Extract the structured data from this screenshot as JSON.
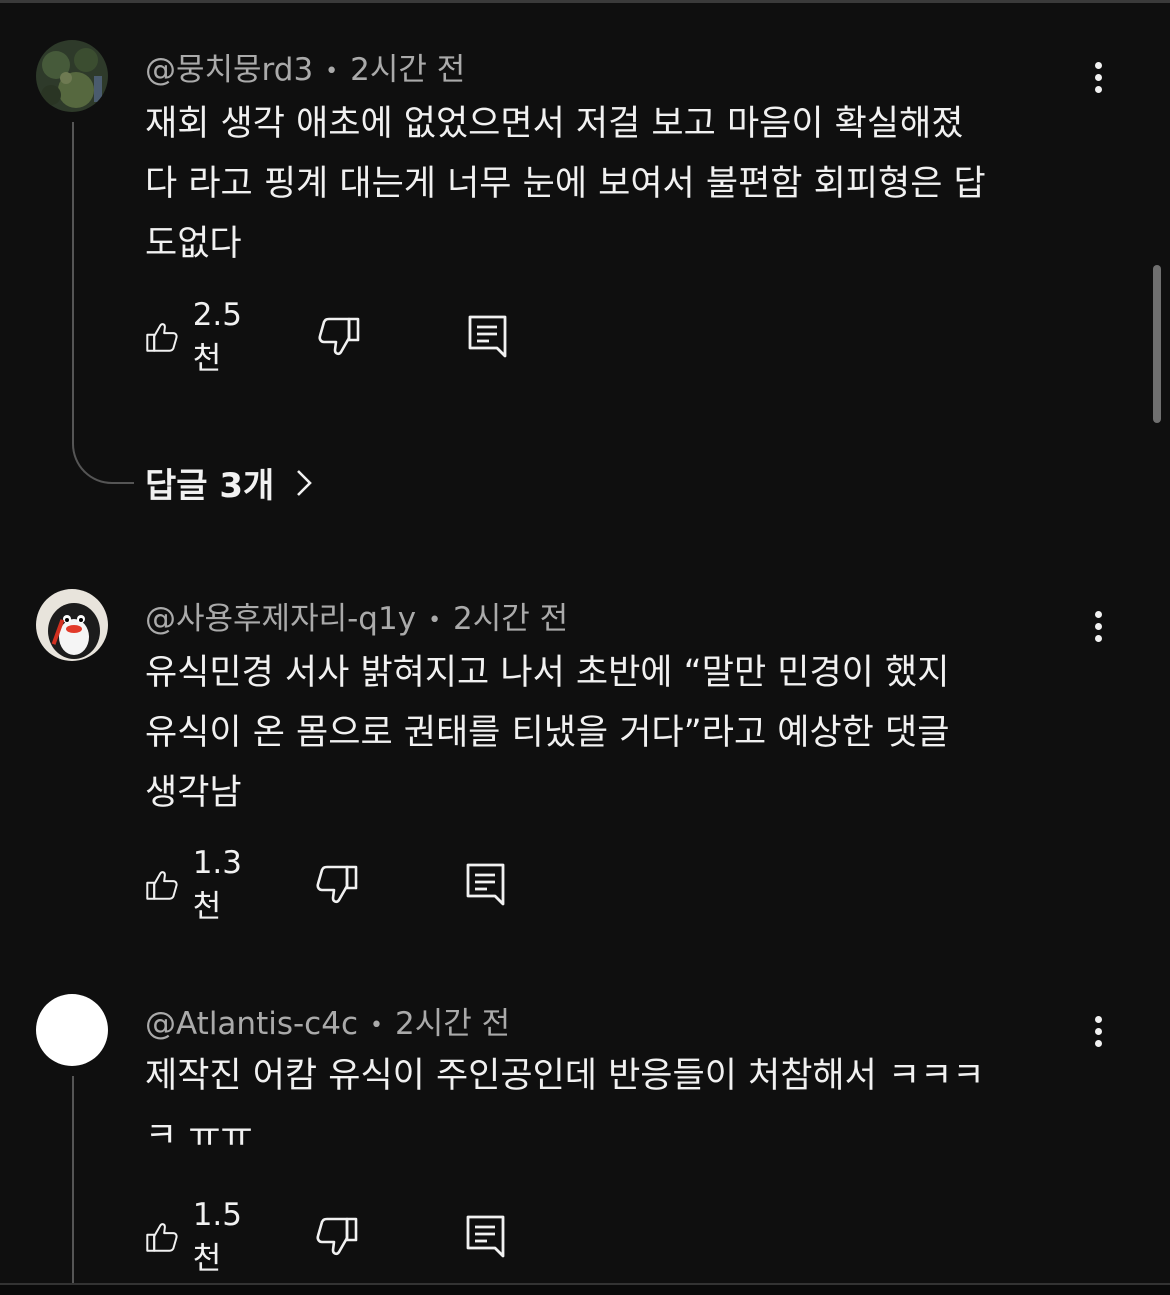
{
  "comments": [
    {
      "author": "@뭉치뭉rd3",
      "time": "2시간 전",
      "lines": [
        "재회 생각 애초에 없었으면서 저걸 보고 마음이 확실해졌",
        "다 라고 핑계 대는게 너무 눈에 보여서 불편함 회피형은 답",
        "도없다"
      ],
      "likes": "2.5천",
      "replies_label": "답글 3개"
    },
    {
      "author": "@사용후제자리-q1y",
      "time": "2시간 전",
      "lines": [
        "유식민경 서사 밝혀지고 나서 초반에 “말만 민경이 했지",
        "유식이 온 몸으로 권태를 티냈을 거다”라고 예상한 댓글",
        "생각남"
      ],
      "likes": "1.3천"
    },
    {
      "author": "@Atlantis-c4c",
      "time": "2시간 전",
      "lines": [
        "제작진 어캄 유식이 주인공인데 반응들이 처참해서 ㅋㅋㅋ",
        "ㅋ ㅠㅠ"
      ],
      "likes": "1.5천"
    }
  ],
  "icons": {
    "like": "thumb-up-icon",
    "dislike": "thumb-down-icon",
    "reply": "comment-reply-icon",
    "more": "more-vert-icon",
    "chevron": "chevron-right-icon"
  },
  "colors": {
    "background": "#0f0f0f",
    "text": "#f1f1f1",
    "meta": "#aaaaaa"
  }
}
